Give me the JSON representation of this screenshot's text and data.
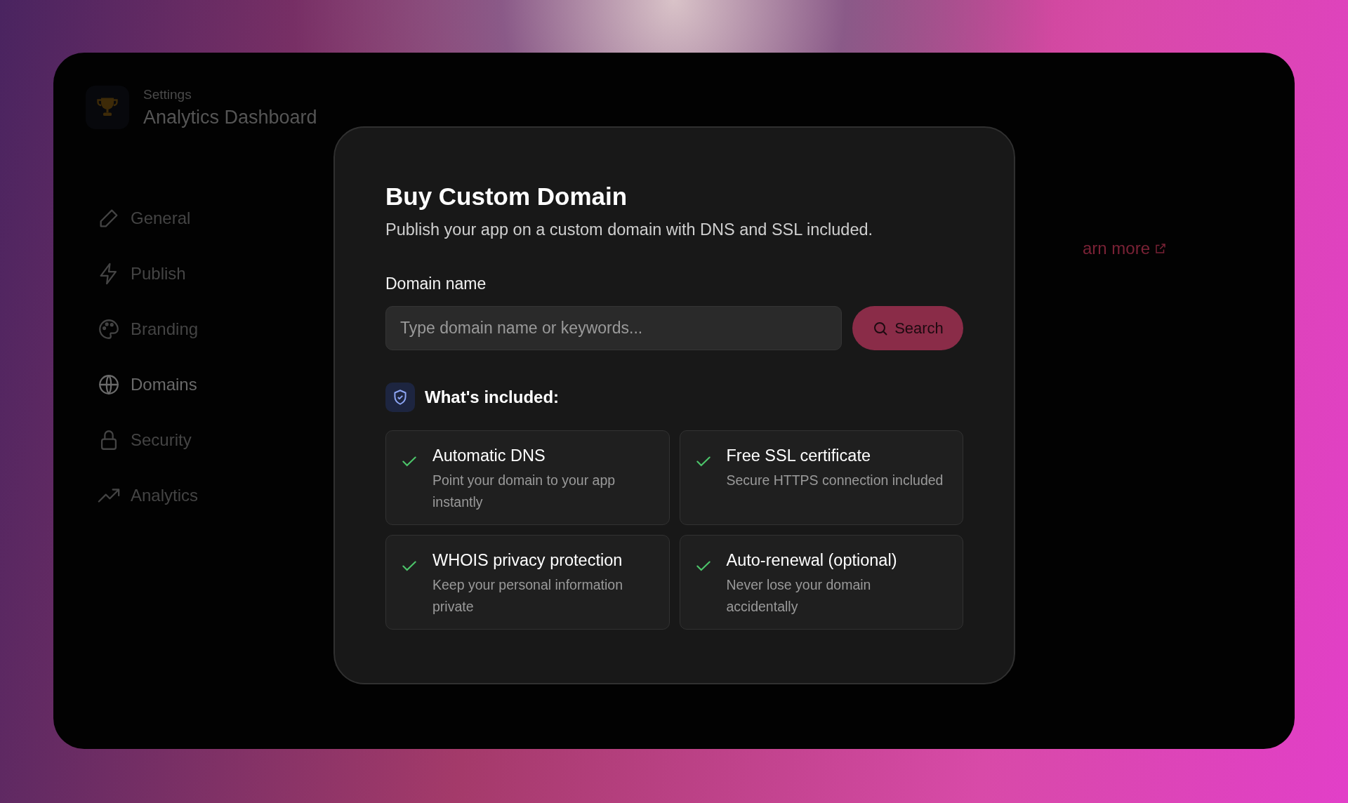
{
  "sidebar": {
    "eyebrow": "Settings",
    "title": "Analytics Dashboard",
    "items": [
      {
        "label": "General",
        "selected": false
      },
      {
        "label": "Publish",
        "selected": false
      },
      {
        "label": "Branding",
        "selected": false
      },
      {
        "label": "Domains",
        "selected": true
      },
      {
        "label": "Security",
        "selected": false
      },
      {
        "label": "Analytics",
        "selected": false
      }
    ]
  },
  "main": {
    "link": "arn more"
  },
  "dialog": {
    "title": "Buy Custom Domain",
    "subtitle": "Publish your app on a custom domain with DNS and SSL included.",
    "field_label": "Domain name",
    "search": {
      "placeholder": "Type domain name or keywords..."
    },
    "search_button": "Search",
    "included_heading": "What's included:",
    "features": [
      {
        "title": "Automatic DNS",
        "description": "Point your domain to your app instantly"
      },
      {
        "title": "Free SSL certificate",
        "description": "Secure HTTPS connection included"
      },
      {
        "title": "WHOIS privacy protection",
        "description": "Keep your personal information private"
      },
      {
        "title": "Auto-renewal (optional)",
        "description": "Never lose your domain accidentally"
      }
    ]
  }
}
